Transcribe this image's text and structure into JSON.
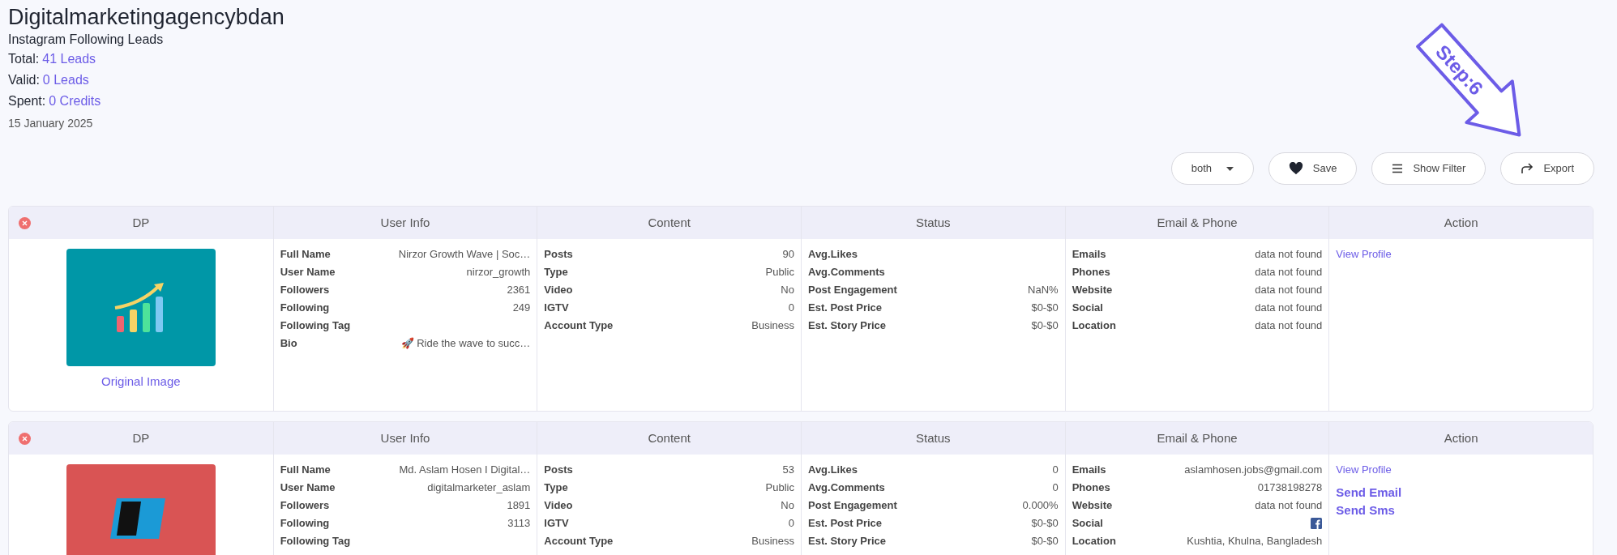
{
  "account": {
    "title": "Digitalmarketingagencybdan",
    "subtitle": "Instagram Following Leads",
    "stats": [
      {
        "label": "Total:",
        "value": "41 Leads"
      },
      {
        "label": "Valid:",
        "value": "0 Leads"
      },
      {
        "label": "Spent:",
        "value": "0 Credits"
      }
    ],
    "date": "15 January 2025"
  },
  "step_badge": {
    "label": "Step:6"
  },
  "toolbar": {
    "dropdown": {
      "value": "both"
    },
    "buttons": [
      {
        "label": "Save",
        "kind": "save"
      },
      {
        "label": "Show Filter",
        "kind": "filter"
      },
      {
        "label": "Export",
        "kind": "export"
      }
    ]
  },
  "leads": [
    {
      "columns": [
        "DP",
        "User Info",
        "Content",
        "Status",
        "Email & Phone",
        "Action"
      ],
      "image": {
        "kind": "chart-logo",
        "caption": "Original Image"
      },
      "user_info": [
        {
          "label": "Full Name",
          "value": "Nirzor Growth Wave | Soc…"
        },
        {
          "label": "User Name",
          "value": "nirzor_growth"
        },
        {
          "label": "Followers",
          "value": "2361"
        },
        {
          "label": "Following",
          "value": "249"
        },
        {
          "label": "Following Tag"
        },
        {
          "label": "Bio",
          "value": "🚀 Ride the wave to succ…"
        }
      ],
      "content": [
        {
          "label": "Posts",
          "value": "90"
        },
        {
          "label": "Type",
          "value": "Public"
        },
        {
          "label": "Video",
          "value": "No"
        },
        {
          "label": "IGTV",
          "value": "0"
        },
        {
          "label": "Account Type",
          "value": "Business"
        }
      ],
      "status": [
        {
          "label": "Avg.Likes"
        },
        {
          "label": "Avg.Comments"
        },
        {
          "label": "Post Engagement",
          "value": "NaN%"
        },
        {
          "label": "Est. Post Price",
          "value": "$0-$0"
        },
        {
          "label": "Est. Story Price",
          "value": "$0-$0"
        }
      ],
      "email_phone": [
        {
          "label": "Emails",
          "kind": "text",
          "value": "data not found"
        },
        {
          "label": "Phones",
          "kind": "text",
          "value": "data not found"
        },
        {
          "label": "Website",
          "kind": "text",
          "value": "data not found"
        },
        {
          "label": "Social",
          "kind": "text",
          "value": "data not found"
        },
        {
          "label": "Location",
          "kind": "text",
          "value": "data not found"
        }
      ],
      "actions": [
        {
          "label": "View Profile",
          "kind": "link"
        }
      ]
    },
    {
      "columns": [
        "DP",
        "User Info",
        "Content",
        "Status",
        "Email & Phone",
        "Action"
      ],
      "image": {
        "kind": "letters-logo"
      },
      "user_info": [
        {
          "label": "Full Name",
          "value": "Md. Aslam Hosen I Digital…"
        },
        {
          "label": "User Name",
          "value": "digitalmarketer_aslam"
        },
        {
          "label": "Followers",
          "value": "1891"
        },
        {
          "label": "Following",
          "value": "3113"
        },
        {
          "label": "Following Tag"
        }
      ],
      "content": [
        {
          "label": "Posts",
          "value": "53"
        },
        {
          "label": "Type",
          "value": "Public"
        },
        {
          "label": "Video",
          "value": "No"
        },
        {
          "label": "IGTV",
          "value": "0"
        },
        {
          "label": "Account Type",
          "value": "Business"
        }
      ],
      "status": [
        {
          "label": "Avg.Likes",
          "value": "0"
        },
        {
          "label": "Avg.Comments",
          "value": "0"
        },
        {
          "label": "Post Engagement",
          "value": "0.000%"
        },
        {
          "label": "Est. Post Price",
          "value": "$0-$0"
        },
        {
          "label": "Est. Story Price",
          "value": "$0-$0"
        }
      ],
      "email_phone": [
        {
          "label": "Emails",
          "kind": "text",
          "value": "aslamhosen.jobs@gmail.com"
        },
        {
          "label": "Phones",
          "kind": "text",
          "value": "01738198278"
        },
        {
          "label": "Website",
          "kind": "text",
          "value": "data not found"
        },
        {
          "label": "Social",
          "kind": "facebook"
        },
        {
          "label": "Location",
          "kind": "text",
          "value": "Kushtia, Khulna, Bangladesh"
        }
      ],
      "actions": [
        {
          "label": "View Profile",
          "kind": "link"
        },
        {
          "label": "Send Email",
          "kind": "action"
        },
        {
          "label": "Send Sms",
          "kind": "action"
        }
      ]
    }
  ]
}
